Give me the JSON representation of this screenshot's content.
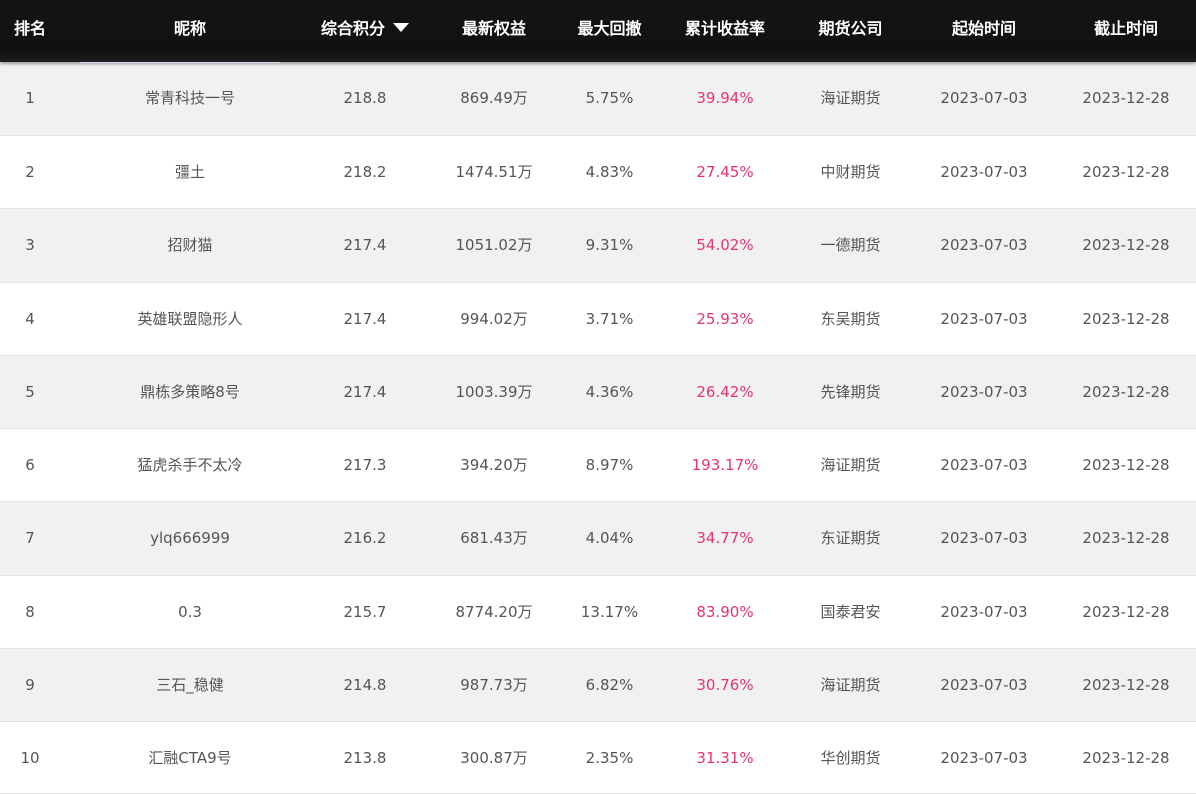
{
  "headers": [
    "排名",
    "昵称",
    "综合积分",
    "最新权益",
    "最大回撤",
    "累计收益率",
    "期货公司",
    "起始时间",
    "截止时间"
  ],
  "sort": {
    "column": "综合积分",
    "direction": "desc",
    "icon": "caret-down-icon"
  },
  "colors": {
    "header_bg": "#111111",
    "header_text": "#ffffff",
    "row_odd": "#f1f1f1",
    "row_even": "#ffffff",
    "cell_text": "#555555",
    "return_text": "#e8336d"
  },
  "rows": [
    {
      "rank": "1",
      "name": "常青科技一号",
      "score": "218.8",
      "equity": "869.49万",
      "drawdown": "5.75%",
      "return": "39.94%",
      "company": "海证期货",
      "start": "2023-07-03",
      "end": "2023-12-28"
    },
    {
      "rank": "2",
      "name": "彊土",
      "score": "218.2",
      "equity": "1474.51万",
      "drawdown": "4.83%",
      "return": "27.45%",
      "company": "中财期货",
      "start": "2023-07-03",
      "end": "2023-12-28"
    },
    {
      "rank": "3",
      "name": "招财猫",
      "score": "217.4",
      "equity": "1051.02万",
      "drawdown": "9.31%",
      "return": "54.02%",
      "company": "一德期货",
      "start": "2023-07-03",
      "end": "2023-12-28"
    },
    {
      "rank": "4",
      "name": "英雄联盟隐形人",
      "score": "217.4",
      "equity": "994.02万",
      "drawdown": "3.71%",
      "return": "25.93%",
      "company": "东吴期货",
      "start": "2023-07-03",
      "end": "2023-12-28"
    },
    {
      "rank": "5",
      "name": "鼎栋多策略8号",
      "score": "217.4",
      "equity": "1003.39万",
      "drawdown": "4.36%",
      "return": "26.42%",
      "company": "先锋期货",
      "start": "2023-07-03",
      "end": "2023-12-28"
    },
    {
      "rank": "6",
      "name": "猛虎杀手不太冷",
      "score": "217.3",
      "equity": "394.20万",
      "drawdown": "8.97%",
      "return": "193.17%",
      "company": "海证期货",
      "start": "2023-07-03",
      "end": "2023-12-28"
    },
    {
      "rank": "7",
      "name": "ylq666999",
      "score": "216.2",
      "equity": "681.43万",
      "drawdown": "4.04%",
      "return": "34.77%",
      "company": "东证期货",
      "start": "2023-07-03",
      "end": "2023-12-28"
    },
    {
      "rank": "8",
      "name": "0.3",
      "score": "215.7",
      "equity": "8774.20万",
      "drawdown": "13.17%",
      "return": "83.90%",
      "company": "国泰君安",
      "start": "2023-07-03",
      "end": "2023-12-28"
    },
    {
      "rank": "9",
      "name": "三石_稳健",
      "score": "214.8",
      "equity": "987.73万",
      "drawdown": "6.82%",
      "return": "30.76%",
      "company": "海证期货",
      "start": "2023-07-03",
      "end": "2023-12-28"
    },
    {
      "rank": "10",
      "name": "汇融CTA9号",
      "score": "213.8",
      "equity": "300.87万",
      "drawdown": "2.35%",
      "return": "31.31%",
      "company": "华创期货",
      "start": "2023-07-03",
      "end": "2023-12-28"
    }
  ]
}
